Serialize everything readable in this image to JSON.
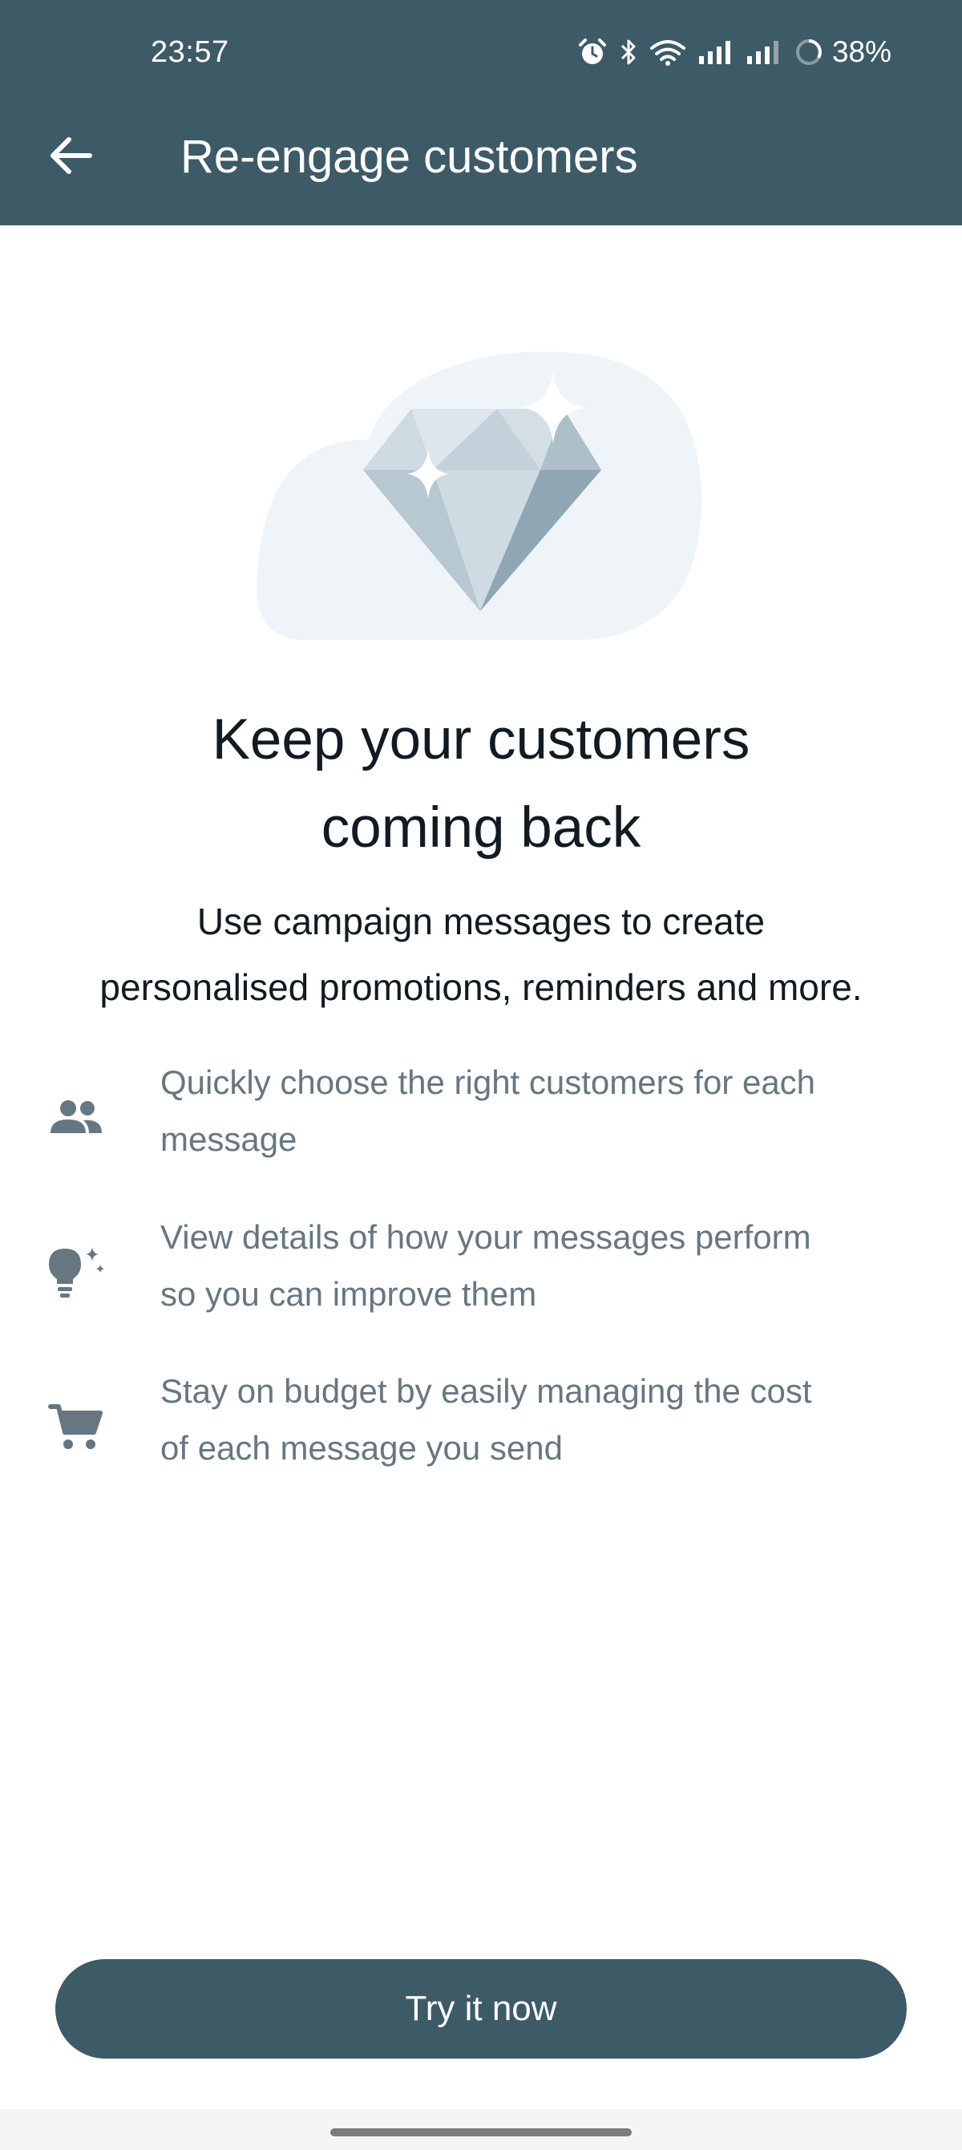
{
  "status_bar": {
    "time": "23:57",
    "battery": "38%",
    "icons": [
      "alarm-icon",
      "bluetooth-icon",
      "wifi-icon",
      "signal-icon",
      "signal-icon",
      "battery-ring-icon"
    ]
  },
  "app_bar": {
    "title": "Re-engage customers",
    "back_icon": "arrow-back-icon",
    "color": "#3d5a67"
  },
  "hero": {
    "illustration": "diamond-sparkle-illustration"
  },
  "headline": {
    "line1": "Keep your customers",
    "line2": "coming back"
  },
  "subtitle": {
    "line1": "Use campaign messages to create",
    "line2": "personalised promotions, reminders and more."
  },
  "features": [
    {
      "icon": "people-icon",
      "line1": "Quickly choose the right customers for each",
      "line2": "message"
    },
    {
      "icon": "lightbulb-sparkle-icon",
      "line1": "View details of how your messages perform",
      "line2": "so you can improve them"
    },
    {
      "icon": "cart-icon",
      "line1": "Stay on budget by easily managing the cost",
      "line2": "of each message you send"
    }
  ],
  "cta": {
    "label": "Try it now",
    "color": "#3d5a67"
  }
}
